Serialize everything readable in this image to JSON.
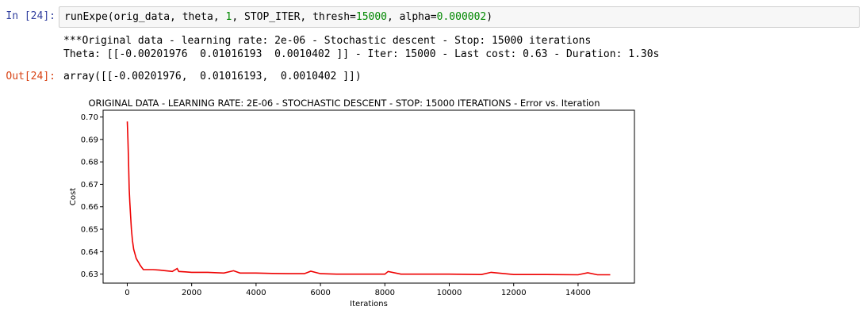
{
  "cell_in": {
    "prompt": "In [24]:",
    "code_prefix": "runExpe(orig_data, theta, ",
    "arg_1": "1",
    "code_mid": ", STOP_ITER, thresh=",
    "arg_thresh": "15000",
    "code_mid2": ", alpha=",
    "arg_alpha": "0.000002",
    "code_suffix": ")"
  },
  "stdout": {
    "line1": "***Original data - learning rate: 2e-06 - Stochastic descent - Stop: 15000 iterations",
    "line2": "Theta: [[-0.00201976  0.01016193  0.0010402 ]] - Iter: 15000 - Last cost: 0.63 - Duration: 1.30s"
  },
  "cell_out": {
    "prompt": "Out[24]:",
    "value": "array([[-0.00201976,  0.01016193,  0.0010402 ]])"
  },
  "colors": {
    "line": "#ee0000",
    "input_prompt": "#303f9f",
    "output_prompt": "#d84315"
  },
  "chart_data": {
    "type": "line",
    "title": "ORIGINAL DATA - LEARNING RATE: 2E-06 - STOCHASTIC DESCENT - STOP: 15000 ITERATIONS - Error vs. Iteration",
    "xlabel": "Iterations",
    "ylabel": "Cost",
    "xlim": [
      -750,
      15750
    ],
    "ylim": [
      0.626,
      0.703
    ],
    "xticks": [
      0,
      2000,
      4000,
      6000,
      8000,
      10000,
      12000,
      14000
    ],
    "yticks": [
      0.63,
      0.64,
      0.65,
      0.66,
      0.67,
      0.68,
      0.69,
      0.7
    ],
    "ytick_labels": [
      "0.63",
      "0.64",
      "0.65",
      "0.66",
      "0.67",
      "0.68",
      "0.69",
      "0.70"
    ],
    "grid": false,
    "series": [
      {
        "x": [
          0,
          20,
          40,
          60,
          80,
          100,
          130,
          160,
          200,
          240,
          280,
          320,
          360,
          400,
          450,
          500,
          600,
          700,
          800,
          1000,
          1200,
          1400,
          1550,
          1600,
          1800,
          2000,
          2500,
          3000,
          3300,
          3500,
          4000,
          4500,
          5000,
          5500,
          5700,
          6000,
          6500,
          7000,
          7500,
          8000,
          8100,
          8500,
          9000,
          10000,
          11000,
          11300,
          12000,
          13000,
          14000,
          14300,
          14600,
          15000
        ],
        "y": [
          0.698,
          0.69,
          0.68,
          0.668,
          0.662,
          0.657,
          0.65,
          0.645,
          0.641,
          0.639,
          0.637,
          0.636,
          0.635,
          0.634,
          0.633,
          0.632,
          0.632,
          0.632,
          0.632,
          0.6318,
          0.6315,
          0.6312,
          0.6325,
          0.6312,
          0.631,
          0.6308,
          0.6308,
          0.6305,
          0.6315,
          0.6305,
          0.6305,
          0.6303,
          0.6302,
          0.6302,
          0.6313,
          0.6302,
          0.63,
          0.63,
          0.63,
          0.63,
          0.6312,
          0.63,
          0.63,
          0.63,
          0.6298,
          0.6308,
          0.6298,
          0.6298,
          0.6297,
          0.6306,
          0.6297,
          0.6297
        ]
      }
    ]
  }
}
